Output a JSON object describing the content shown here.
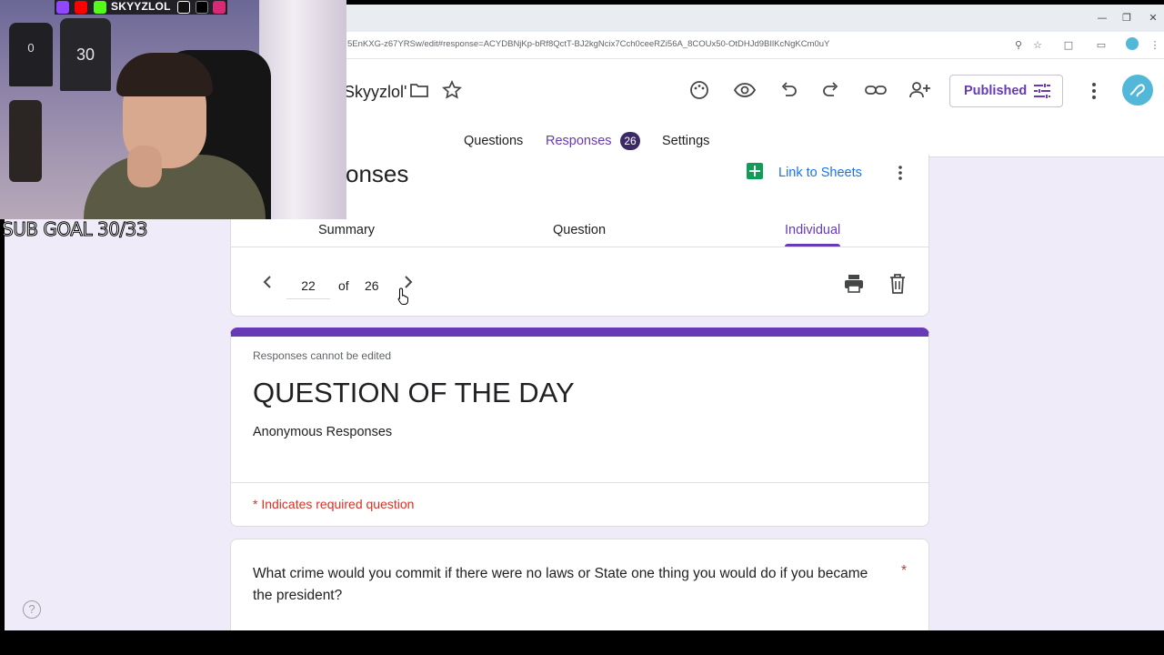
{
  "browser": {
    "url": "5EnKXG-z67YRSw/edit#response=ACYDBNjKp-bRf8QctT-BJ2kgNcix7Cch0ceeRZi56A_8COUx50-OtDHJd9BIlKcNgKCm0uY"
  },
  "forms_header": {
    "doc_title": "Skyyzlol'",
    "published_label": "Published",
    "tabs": {
      "questions": "Questions",
      "responses": "Responses",
      "responses_count": "26",
      "settings": "Settings"
    }
  },
  "responses_card": {
    "title": "onses",
    "link_to_sheets": "Link to Sheets",
    "subtabs": {
      "summary": "Summary",
      "question": "Question",
      "individual": "Individual"
    },
    "pager": {
      "current": "22",
      "of": "of",
      "total": "26"
    }
  },
  "form_card": {
    "no_edit_notice": "Responses cannot be edited",
    "title": "QUESTION OF THE DAY",
    "description": "Anonymous Responses",
    "required_note": "* Indicates required question"
  },
  "question_card": {
    "text": "What crime would you commit if there were no laws or  State one thing you would do if you became the  president?",
    "required_star": "*"
  },
  "webcam_overlay": {
    "social_handle": "SKYYZLOL",
    "sub_goal": "SUB GOAL 30/33",
    "jersey_number_1": "0",
    "jersey_number_2": "30"
  },
  "colors": {
    "accent": "#673ab7",
    "background": "#f0ebf8",
    "required": "#d93025",
    "link": "#1a73e8"
  },
  "icons": {
    "header": [
      "palette-icon",
      "preview-eye-icon",
      "undo-icon",
      "redo-icon",
      "link-icon",
      "add-collaborator-icon",
      "tune-icon",
      "more-vert-icon"
    ],
    "card": [
      "sheets-icon",
      "more-vert-icon",
      "chevron-left-icon",
      "chevron-right-icon",
      "print-icon",
      "delete-icon"
    ],
    "help": "?"
  }
}
